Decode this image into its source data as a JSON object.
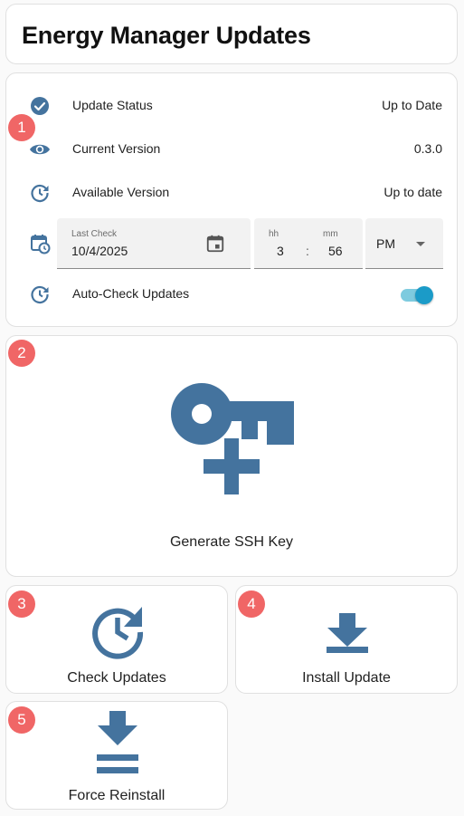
{
  "title": "Energy Manager Updates",
  "colors": {
    "icon": "#44739e",
    "badge": "#f06666",
    "toggle_on": "#1b9bc8"
  },
  "entities": {
    "update_status": {
      "icon": "check-circle-icon",
      "label": "Update Status",
      "value": "Up to Date"
    },
    "current_version": {
      "icon": "eye-icon",
      "label": "Current Version",
      "value": "0.3.0"
    },
    "available_version": {
      "icon": "history-icon",
      "label": "Available Version",
      "value": "Up to date"
    },
    "last_check": {
      "icon": "calendar-clock-icon",
      "label": "Last Check",
      "date": "10/4/2025",
      "hh_label": "hh",
      "mm_label": "mm",
      "hour": "3",
      "minute": "56",
      "separator": ":",
      "ampm": "PM"
    },
    "auto_check": {
      "icon": "history-icon",
      "label": "Auto-Check Updates",
      "enabled": true
    }
  },
  "buttons": {
    "generate_ssh": {
      "icon": "key-plus-icon",
      "label": "Generate SSH Key"
    },
    "check_updates": {
      "icon": "update-icon",
      "label": "Check Updates"
    },
    "install_update": {
      "icon": "download-icon",
      "label": "Install Update"
    },
    "force_reinstall": {
      "icon": "download-force-icon",
      "label": "Force Reinstall"
    }
  },
  "badges": [
    "1",
    "2",
    "3",
    "4",
    "5"
  ]
}
